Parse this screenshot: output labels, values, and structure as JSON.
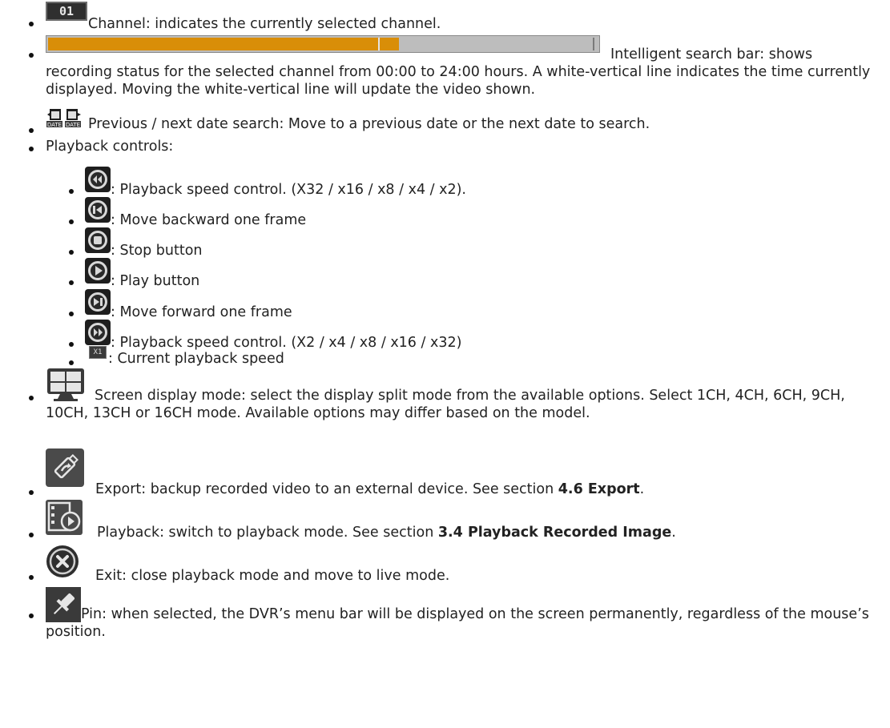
{
  "items": [
    {
      "icon_text": "01",
      "text": "Channel: indicates the currently selected channel."
    },
    {
      "text_line1": "Intelligent search bar: shows",
      "text_rest": "recording status for the selected channel from 00:00 to 24:00 hours. A white-vertical line indicates the time currently displayed. Moving the white-vertical line will update the video shown."
    },
    {
      "text": "Previous / next date search: Move to a previous date or the next date to search."
    },
    {
      "text": "Playback controls:"
    }
  ],
  "controls": [
    {
      "icon": "rewind-icon",
      "text": ": Playback speed control. (X32 / x16 / x8 / x4 / x2)."
    },
    {
      "icon": "step-back-icon",
      "text": ": Move backward one frame"
    },
    {
      "icon": "stop-icon",
      "text": ": Stop button"
    },
    {
      "icon": "play-icon",
      "text": ": Play button"
    },
    {
      "icon": "step-forward-icon",
      "text": ": Move forward one frame"
    },
    {
      "icon": "fast-forward-icon",
      "text": ": Playback speed control. (X2 / x4 / x8 / x16 / x32)"
    },
    {
      "icon": "speed-indicator-icon",
      "icon_text": "X1",
      "text": ": Current playback speed"
    }
  ],
  "display_mode": {
    "text": "Screen display mode: select the display split mode from the available options. Select 1CH, 4CH, 6CH, 9CH, 10CH, 13CH or 16CH mode. Available options may differ based on the model."
  },
  "export": {
    "text_before": "Export: backup recorded video to an external device. See section ",
    "ref": "4.6 Export",
    "text_after": "."
  },
  "playback": {
    "text_before": "Playback: switch to playback mode. See section ",
    "ref": "3.4 Playback Recorded Image",
    "text_after": "."
  },
  "exit": {
    "text": "Exit: close playback mode and move to live mode."
  },
  "pin": {
    "text": "Pin: when selected, the DVR’s menu bar will be displayed on the screen permanently, regardless of the mouse’s position."
  },
  "date_icon_label": "DATE",
  "colors": {
    "recording": "#d98e08",
    "empty": "#bdbdbd",
    "icon_dark": "#1e1e1e"
  }
}
